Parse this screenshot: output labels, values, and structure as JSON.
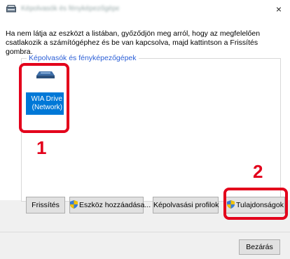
{
  "window": {
    "title": "Képolvasók és fényképezőgépek",
    "close_label": "×"
  },
  "instructions": "Ha nem látja az eszközt a listában, győződjön meg arról, hogy az megfelelően csatlakozik a számítógéphez és be van kapcsolva, majd kattintson a Frissítés gombra.",
  "group": {
    "legend": "Képolvasók és fényképezőgépek",
    "device": {
      "label": "WIA Drive (Network)",
      "icon": "scanner-icon"
    }
  },
  "callouts": {
    "one": "1",
    "two": "2"
  },
  "buttons": {
    "refresh": "Frissítés",
    "add_device": "Eszköz hozzáadása...",
    "scan_profiles": "Képolvasási profilok",
    "properties": "Tulajdonságok",
    "close": "Bezárás"
  },
  "colors": {
    "highlight": "#e3001b",
    "selection": "#0078d7",
    "accent_text": "#2a5ed6"
  }
}
